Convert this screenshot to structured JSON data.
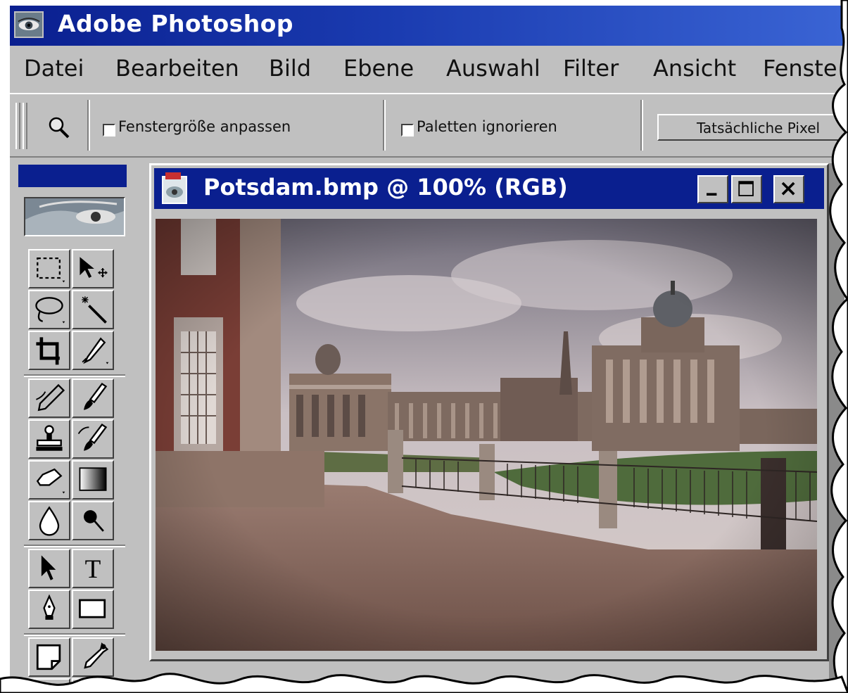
{
  "app": {
    "title": "Adobe Photoshop"
  },
  "menu": [
    {
      "label": "Datei"
    },
    {
      "label": "Bearbeiten"
    },
    {
      "label": "Bild"
    },
    {
      "label": "Ebene"
    },
    {
      "label": "Auswahl"
    },
    {
      "label": "Filter"
    },
    {
      "label": "Ansicht"
    },
    {
      "label": "Fenste"
    }
  ],
  "options": {
    "tool_icon": "zoom-tool-icon",
    "fit_window_label": "Fenstergröße anpassen",
    "fit_window_checked": false,
    "ignore_palettes_label": "Paletten ignorieren",
    "ignore_palettes_checked": false,
    "actual_pixels_label": "Tatsächliche Pixel"
  },
  "toolbox": {
    "tools": [
      "rectangular-marquee-tool-icon",
      "move-tool-icon",
      "lasso-tool-icon",
      "magic-wand-tool-icon",
      "crop-tool-icon",
      "eyedropper-airbrush-tool-icon",
      "pencil-tool-icon",
      "paintbrush-tool-icon",
      "rubber-stamp-tool-icon",
      "history-brush-tool-icon",
      "eraser-tool-icon",
      "gradient-tool-icon",
      "blur-tool-icon",
      "burn-tool-icon",
      "path-selection-tool-icon",
      "type-tool-icon",
      "pen-tool-icon",
      "rectangle-shape-tool-icon",
      "notes-tool-icon",
      "eyedropper-tool-icon",
      "hand-tool-icon",
      "zoom-tool-icon"
    ],
    "type_tool_glyph": "T"
  },
  "document": {
    "title": "Potsdam.bmp @ 100% (RGB)",
    "image_description": "Potsdam.bmp",
    "colors": {
      "title_bar": "#0a1f8f",
      "window_bg": "#c0c0c0"
    }
  }
}
